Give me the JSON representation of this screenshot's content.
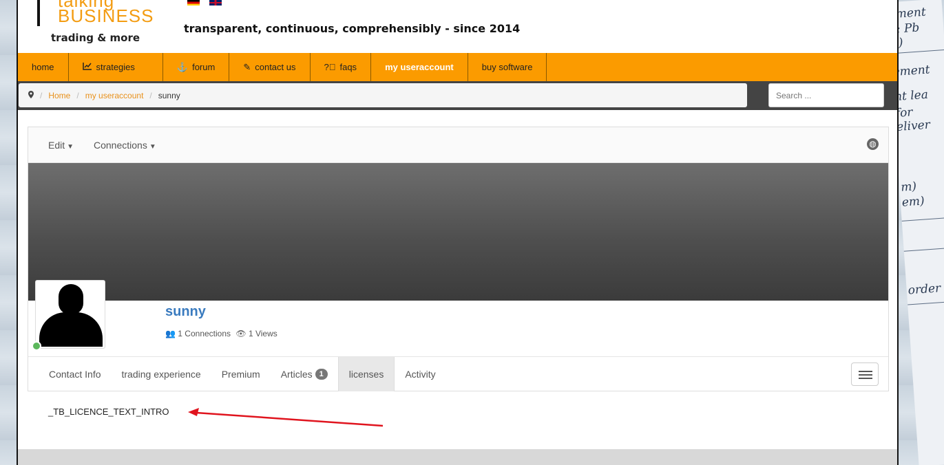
{
  "logo": {
    "top_text": "talking",
    "main_text": "BUSINESS",
    "sub_text": "trading & more"
  },
  "header": {
    "tagline": "transparent, continuous, comprehensibly - since 2014"
  },
  "nav": {
    "items": [
      {
        "label": "home",
        "icon": ""
      },
      {
        "label": "strategies",
        "icon": "chart-line-icon"
      },
      {
        "label": "forum",
        "icon": "anchor-icon"
      },
      {
        "label": "contact us",
        "icon": "edit-icon"
      },
      {
        "label": "faqs",
        "icon": "question-circle-icon"
      },
      {
        "label": "my useraccount",
        "icon": ""
      },
      {
        "label": "buy software",
        "icon": ""
      }
    ],
    "active": "my useraccount"
  },
  "breadcrumb": {
    "home": "Home",
    "section": "my useraccount",
    "current": "sunny"
  },
  "search": {
    "placeholder": "Search ..."
  },
  "profile_toolbar": {
    "edit": "Edit",
    "connections": "Connections"
  },
  "profile": {
    "name": "sunny",
    "connections": "1 Connections",
    "views": "1 Views",
    "status": "online",
    "status_color": "#5cb85c"
  },
  "tabs": {
    "contact": "Contact Info",
    "trading": "trading experience",
    "premium": "Premium",
    "articles": "Articles",
    "articles_count": "1",
    "licenses": "licenses",
    "activity": "Activity",
    "active": "licenses"
  },
  "content": {
    "text": "_TB_LICENCE_TEXT_INTRO"
  },
  "colors": {
    "nav_bg": "#fb9b00",
    "link": "#e8901a",
    "username": "#3a7bbf",
    "annotation_arrow": "#e0141e"
  }
}
